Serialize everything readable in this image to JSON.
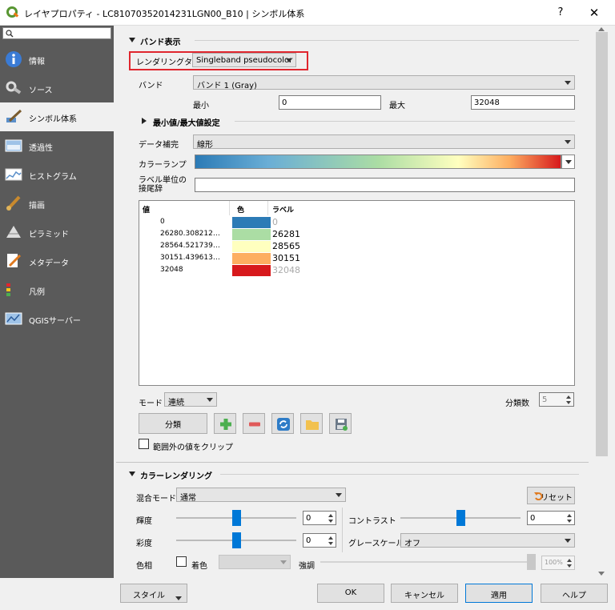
{
  "window": {
    "title": "レイヤプロパティ - LC81070352014231LGN00_B10 | シンボル体系",
    "help": "?",
    "close": "✕"
  },
  "sidebar": {
    "search_placeholder": "",
    "items": [
      {
        "label": "情報",
        "icon": "info-icon"
      },
      {
        "label": "ソース",
        "icon": "source-icon"
      },
      {
        "label": "シンボル体系",
        "icon": "symbology-icon",
        "active": true
      },
      {
        "label": "透過性",
        "icon": "transparency-icon"
      },
      {
        "label": "ヒストグラム",
        "icon": "histogram-icon"
      },
      {
        "label": "描画",
        "icon": "rendering-icon"
      },
      {
        "label": "ピラミッド",
        "icon": "pyramid-icon"
      },
      {
        "label": "メタデータ",
        "icon": "metadata-icon"
      },
      {
        "label": "凡例",
        "icon": "legend-icon"
      },
      {
        "label": "QGISサーバー",
        "icon": "server-icon"
      }
    ]
  },
  "band_render": {
    "group_title": "バンド表示",
    "render_type_label": "レンダリングタイプ",
    "render_type_value": "Singleband pseudocolor",
    "band_label": "バンド",
    "band_value": "バンド 1 (Gray)",
    "min_label": "最小",
    "min_value": "0",
    "max_label": "最大",
    "max_value": "32048",
    "minmax_title": "最小値/最大値設定",
    "interp_label": "データ補完",
    "interp_value": "線形",
    "ramp_label": "カラーランプ",
    "unit_label": "ラベル単位の\n接尾辞",
    "unit_value": "",
    "table_headers": {
      "value": "値",
      "color": "色",
      "label": "ラベル"
    },
    "rows": [
      {
        "value": "0",
        "color": "#2c7bb6",
        "label": "0",
        "label_color": "#aaaaaa"
      },
      {
        "value": "26280.308212…",
        "color": "#abdda4",
        "label": "26281",
        "label_color": "#000000"
      },
      {
        "value": "28564.521739…",
        "color": "#ffffbf",
        "label": "28565",
        "label_color": "#000000"
      },
      {
        "value": "30151.439613…",
        "color": "#fdae61",
        "label": "30151",
        "label_color": "#000000"
      },
      {
        "value": "32048",
        "color": "#d7191c",
        "label": "32048",
        "label_color": "#aaaaaa"
      }
    ],
    "mode_label": "モード",
    "mode_value": "連続",
    "classes_label": "分類数",
    "classes_value": "5",
    "classify_button": "分類",
    "clip_label": "範囲外の値をクリップ"
  },
  "color_render": {
    "group_title": "カラーレンダリング",
    "blend_label": "混合モード",
    "blend_value": "通常",
    "reset_button": "リセット",
    "brightness_label": "輝度",
    "brightness_value": "0",
    "contrast_label": "コントラスト",
    "contrast_value": "0",
    "saturation_label": "彩度",
    "saturation_value": "0",
    "grayscale_label": "グレースケール",
    "grayscale_value": "オフ",
    "hue_label": "色相",
    "colorize_label": "着色",
    "strength_label": "強調",
    "strength_value": "100%"
  },
  "buttons": {
    "style": "スタイル",
    "ok": "OK",
    "cancel": "キャンセル",
    "apply": "適用",
    "help": "ヘルプ"
  },
  "colors": {
    "sidebar": "#5a5a5a",
    "accent": "#0078d7",
    "highlight_box": "#e0262e"
  }
}
